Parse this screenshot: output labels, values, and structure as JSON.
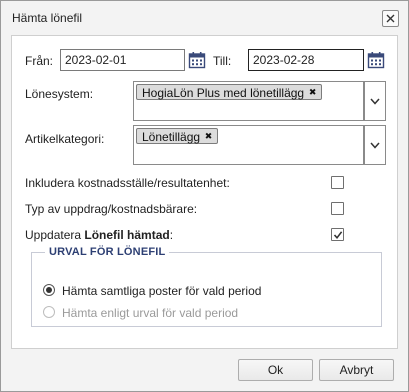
{
  "dialog": {
    "title": "Hämta lönefil"
  },
  "form": {
    "from_label": "Från:",
    "from_value": "2023-02-01",
    "to_label": "Till:",
    "to_value": "2023-02-28",
    "lonesystem_label": "Lönesystem:",
    "lonesystem_selected": "HogiaLön Plus med lönetillägg",
    "artikelkategori_label": "Artikelkategori:",
    "artikelkategori_selected": "Lönetillägg",
    "include_cost_center_label": "Inkludera kostnadsställe/resultatenhet:",
    "include_cost_center_checked": false,
    "assignment_type_label": "Typ av uppdrag/kostnadsbärare:",
    "assignment_type_checked": false,
    "update_label_prefix": "Uppdatera",
    "update_label_bold": "Lönefil hämtad",
    "update_label_suffix": ":",
    "update_checked": true
  },
  "urval": {
    "legend": "URVAL FÖR LÖNEFIL",
    "option_all": "Hämta samtliga poster för vald period",
    "option_selection": "Hämta enligt urval för vald period",
    "selected": "all"
  },
  "buttons": {
    "ok": "Ok",
    "cancel": "Avbryt"
  },
  "icons": {
    "close": "close-icon",
    "calendar": "calendar-icon",
    "chevron": "chevron-down-icon",
    "chip_remove": "remove-tag-icon",
    "check": "check-icon"
  },
  "colors": {
    "legend": "#2d3f73",
    "calendar_icon": "#3a4a7a"
  }
}
